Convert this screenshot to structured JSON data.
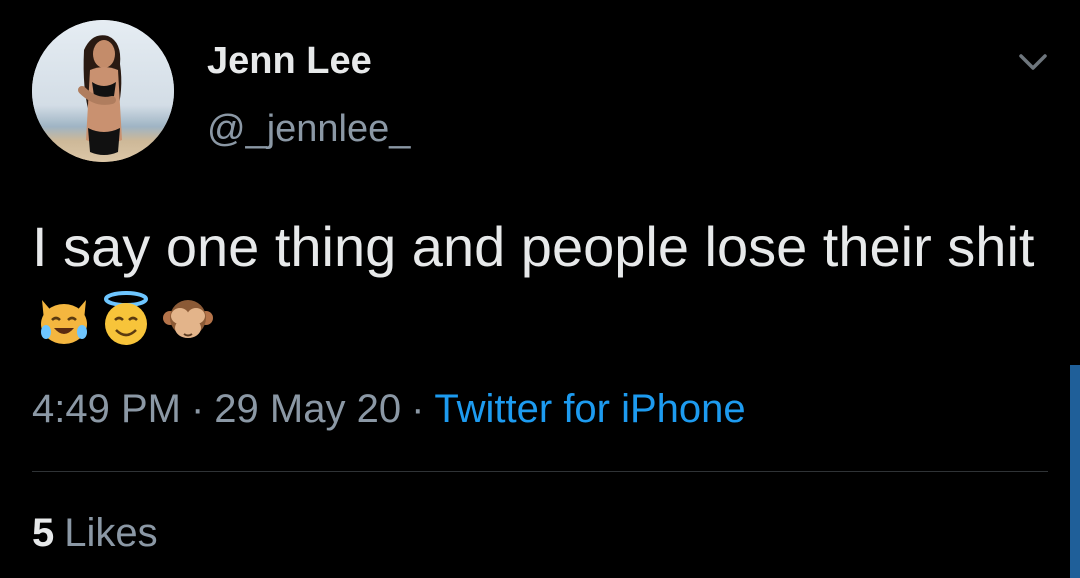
{
  "author": {
    "display_name": "Jenn Lee",
    "handle": "@_jennlee_"
  },
  "tweet": {
    "text": "I say one thing and people lose their shit",
    "emojis": [
      "cat-tears-of-joy-icon",
      "smiling-face-halo-icon",
      "see-no-evil-monkey-icon"
    ]
  },
  "meta": {
    "time": "4:49 PM",
    "date": "29 May 20",
    "separator": "·",
    "source": "Twitter for iPhone"
  },
  "stats": {
    "likes_count": "5",
    "likes_label": "Likes"
  },
  "colors": {
    "background": "#000000",
    "text_primary": "#e7e9ea",
    "text_secondary": "#8b98a5",
    "link": "#1d9bf0",
    "divider": "#2f3336"
  }
}
